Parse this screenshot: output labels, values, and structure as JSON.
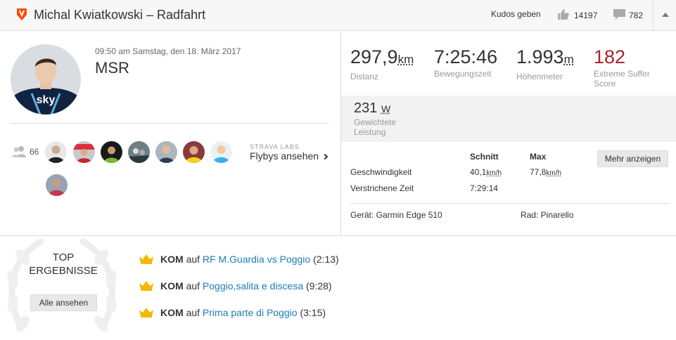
{
  "header": {
    "title": "Michal Kwiatkowski – Radfahrt",
    "kudos_label": "Kudos geben",
    "kudos_count": "14197",
    "comment_count": "782"
  },
  "activity": {
    "datetime": "09:50 am Samstag, den 18. März 2017",
    "name": "MSR"
  },
  "flybys": {
    "group_count": "66",
    "strava_labs": "STRAVA LABS",
    "link": "Flybys ansehen"
  },
  "stats": {
    "distance": {
      "value": "297,9",
      "unit": "km",
      "label": "Distanz"
    },
    "moving_time": {
      "value": "7:25:46",
      "label": "Bewegungszeit"
    },
    "elevation": {
      "value": "1.993",
      "unit": "m",
      "label": "Höhenmeter"
    },
    "suffer": {
      "value": "182",
      "label": "Extreme Suffer Score"
    },
    "weighted_power": {
      "value": "231",
      "unit": "W",
      "label": "Gewichtete Leistung"
    }
  },
  "table": {
    "col_avg": "Schnitt",
    "col_max": "Max",
    "speed_label": "Geschwindigkeit",
    "speed_avg": "40,1",
    "speed_max": "77,8",
    "speed_unit": "km/h",
    "elapsed_label": "Verstrichene Zeit",
    "elapsed_value": "7:29:14",
    "more_button": "Mehr anzeigen"
  },
  "gear": {
    "device": "Gerät: Garmin Edge 510",
    "bike": "Rad: Pinarello"
  },
  "top_results": {
    "title_line1": "TOP",
    "title_line2": "ERGEBNISSE",
    "all_button": "Alle ansehen",
    "items": [
      {
        "kom": "KOM",
        "on": "auf",
        "segment": "RF M.Guardia vs Poggio",
        "time": "(2:13)"
      },
      {
        "kom": "KOM",
        "on": "auf",
        "segment": "Poggio,salita e discesa",
        "time": "(9:28)"
      },
      {
        "kom": "KOM",
        "on": "auf",
        "segment": "Prima parte di Poggio",
        "time": "(3:15)"
      }
    ]
  },
  "colors": {
    "accent": "#fc4c02",
    "suffer": "#a6242b",
    "link": "#1a7fb5",
    "crown": "#f5b800"
  }
}
